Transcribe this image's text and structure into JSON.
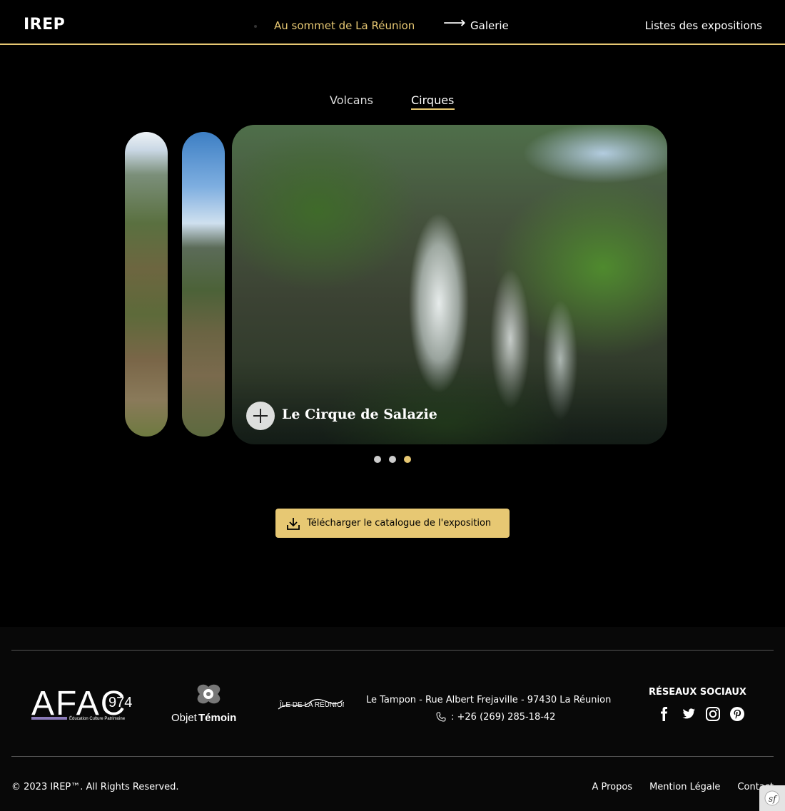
{
  "header": {
    "logo": "IREP",
    "breadcrumb_parent": "Au sommet de La Réunion",
    "breadcrumb_arrow": "⟶",
    "breadcrumb_current": "Galerie",
    "list_link": "Listes des expositions"
  },
  "tabs": [
    {
      "label": "Volcans",
      "active": false
    },
    {
      "label": "Cirques",
      "active": true
    }
  ],
  "carousel": {
    "slide_title": "Le Cirque de Salazie",
    "dot_count": 3,
    "active_dot": 3
  },
  "download_label": "Télécharger le catalogue de l'exposition",
  "footer": {
    "afac_text": "AFAC",
    "afac_number": "974",
    "afac_tagline": "Éducation Culture Patrimoine",
    "objet_text_1": "Objet",
    "objet_text_2": "Témoin",
    "ile_text": "ÎLE DE LA RÉUNION",
    "address": "Le Tampon - Rue Albert Frejaville - 97430 La Réunion",
    "phone": ": +26 (269) 285-18-42",
    "social_title": "RÉSEAUX SOCIAUX",
    "social_icons": [
      "facebook-icon",
      "twitter-icon",
      "instagram-icon",
      "pinterest-icon"
    ],
    "copyright": "© 2023 IREP™. All Rights Reserved.",
    "links": [
      "A Propos",
      "Mention Légale",
      "Contact"
    ]
  },
  "colors": {
    "accent": "#e7c873",
    "background": "#000000"
  }
}
